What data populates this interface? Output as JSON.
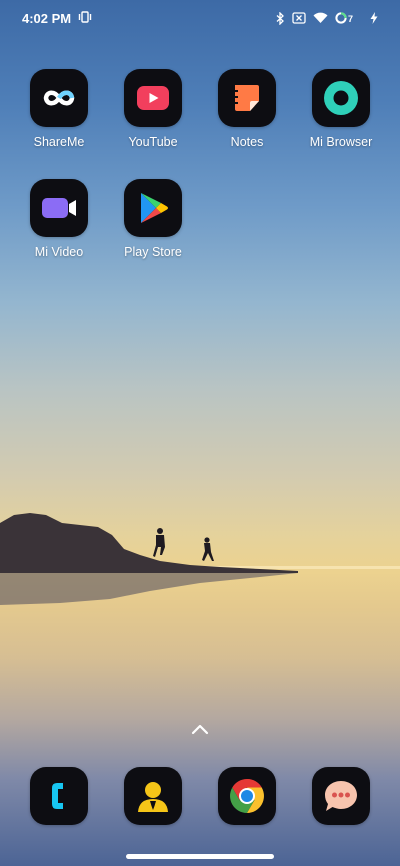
{
  "status_bar": {
    "time": "4:02 PM",
    "icons": [
      "vibrate-icon",
      "bluetooth-icon",
      "close-box-icon",
      "wifi-icon",
      "battery-icon",
      "charging-icon"
    ],
    "battery_level": "7"
  },
  "home": {
    "apps": [
      {
        "label": "ShareMe",
        "icon": "shareme-icon"
      },
      {
        "label": "YouTube",
        "icon": "youtube-icon"
      },
      {
        "label": "Notes",
        "icon": "notes-icon"
      },
      {
        "label": "Mi Browser",
        "icon": "mi-browser-icon"
      },
      {
        "label": "Mi Video",
        "icon": "mi-video-icon"
      },
      {
        "label": "Play Store",
        "icon": "play-store-icon"
      }
    ]
  },
  "dock": {
    "apps": [
      {
        "icon": "phone-icon"
      },
      {
        "icon": "contacts-icon"
      },
      {
        "icon": "chrome-icon"
      },
      {
        "icon": "messages-icon"
      }
    ]
  },
  "colors": {
    "icon_bg": "#0d0d12",
    "youtube_red": "#f23f5d",
    "notes_orange": "#ff7a45",
    "browser_teal": "#2fd0b9",
    "video_purple": "#8b6cf5",
    "phone_cyan": "#17c6f2",
    "contacts_yellow": "#f5c518",
    "messages_peach": "#f7c4ae"
  }
}
